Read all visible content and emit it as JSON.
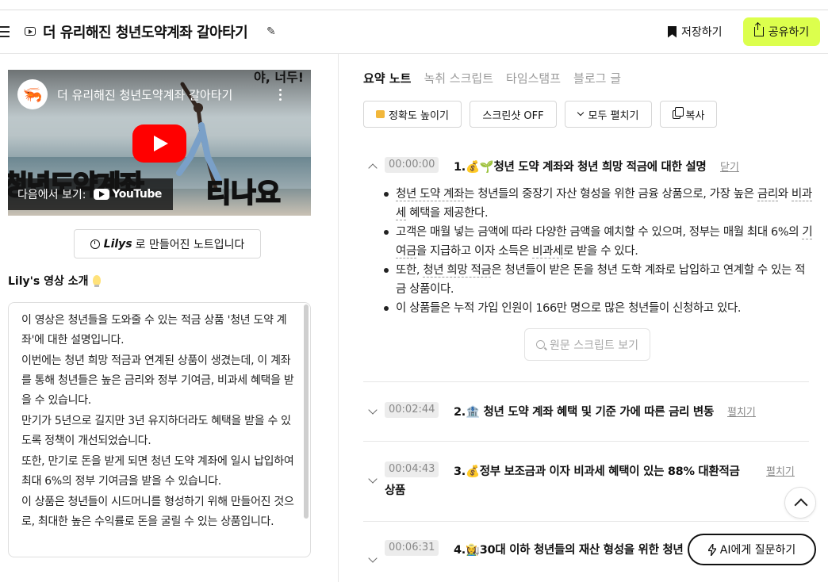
{
  "header": {
    "title": "더 유리해진 청년도약계좌 갈아타기",
    "save_label": "저장하기",
    "share_label": "공유하기"
  },
  "video": {
    "title": "더 유리해진 청년도약계좌 갈아타기",
    "watch_on": "다음에서 보기:",
    "platform": "YouTube",
    "overlay_text_1": "청년도약계좌",
    "overlay_text_2": "티나요",
    "corner_text": "야, 너두!"
  },
  "lilys_badge": {
    "brand": "Lilys",
    "text": "로 만들어진 노트입니다"
  },
  "intro": {
    "title": "Lily's 영상 소개",
    "paragraphs": [
      "이 영상은 청년들을 도와줄 수 있는 적금 상품 '청년 도약 계좌'에 대한 설명입니다.",
      "이번에는 청년 희망 적금과 연계된 상품이 생겼는데, 이 계좌를 통해 청년들은 높은 금리와 정부 기여금, 비과세 혜택을 받을 수 있습니다.",
      "만기가 5년으로 길지만 3년 유지하더라도 혜택을 받을 수 있도록 정책이 개선되었습니다.",
      "또한, 만기로 돈을 받게 되면 청년 도약 계좌에 일시 납입하여 최대 6%의 정부 기여금을 받을 수 있습니다.",
      "이 상품은 청년들이 시드머니를 형성하기 위해 만들어진 것으로, 최대한 높은 수익률로 돈을 굴릴 수 있는 상품입니다."
    ]
  },
  "tabs": [
    "요약 노트",
    "녹취 스크립트",
    "타임스탬프",
    "블로그 글"
  ],
  "toolbar": {
    "accuracy": "정확도 높이기",
    "screenshot": "스크린샷 OFF",
    "expand_all": "모두 펼치기",
    "copy": "복사"
  },
  "sections": [
    {
      "time": "00:00:00",
      "title": "1.💰🌱청년 도약 계좌와 청년 희망 적금에 대한 설명",
      "link": "닫기"
    },
    {
      "time": "00:02:44",
      "title": "2.🏦 청년 도약 계좌 혜택 및 기준 가에 따른 금리 변동",
      "link": "펼치기"
    },
    {
      "time": "00:04:43",
      "title": "3.💰정부 보조금과 이자 비과세 혜택이 있는 88% 대환적금",
      "title_cont": "상품",
      "link": "펼치기"
    },
    {
      "time": "00:06:31",
      "title": "4.👩‍🌾30대 이하 청년들의 재산 형성을 위한 청년"
    }
  ],
  "bullets": {
    "b1": [
      "청년 도약 계좌",
      "는 청년들의 중장기 자산 형성을 위한 금융 상품으로, 가장 높은 ",
      "금리",
      "와 ",
      "비과세",
      " 혜택을 제공한다."
    ],
    "b2": [
      "고객은 매월 넣는 금액에 따라 다양한 금액을 예치할 수 있으며, 정부는 매월 최대 6%의 ",
      "기여금",
      "을 지급하고 이자 소득은 ",
      "비과세",
      "로 받을 수 있다."
    ],
    "b3": [
      "또한, ",
      "청년 희망 적금",
      "은 청년들이 받은 돈을 청년 도학 계좌로 납입하고 연계할 수 있는 적금 상품이다."
    ],
    "b4": "이 상품들은 누적 가입 인원이 166만 명으로 많은 청년들이 신청하고 있다."
  },
  "source_button": "원문 스크립트 보기",
  "ask_ai": "AI에게 질문하기",
  "colors": {
    "share_bg": "#dcff4d",
    "play_red": "#ff0000"
  }
}
